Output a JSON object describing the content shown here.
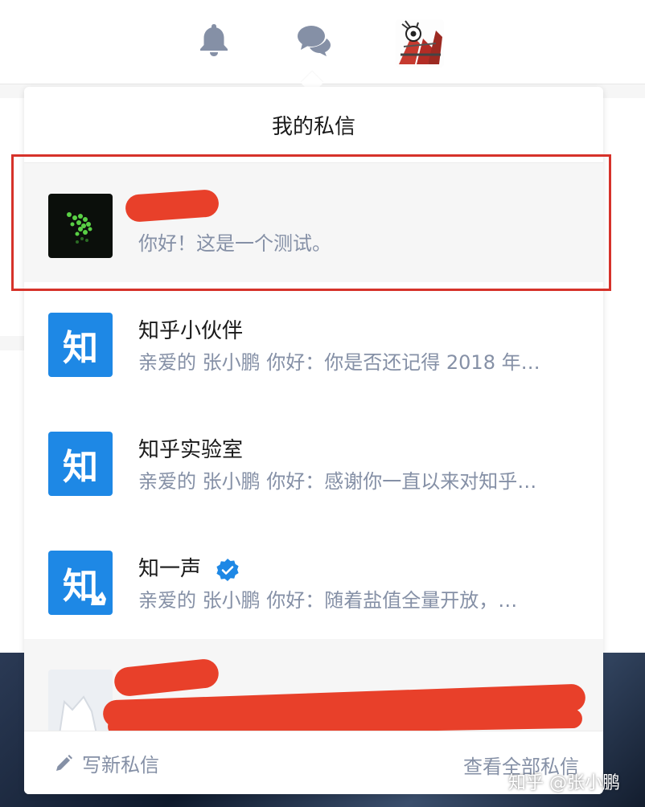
{
  "header": {
    "icons": [
      "bell-icon",
      "chat-bubbles-icon"
    ],
    "avatar": "user-avatar"
  },
  "popup": {
    "title": "我的私信",
    "conversations": [
      {
        "name": "",
        "message": "你好！这是一个测试。",
        "avatar": "green-dots-avatar",
        "redacted": true
      },
      {
        "name": "知乎小伙伴",
        "message": "亲爱的 张小鹏 你好：你是否还记得 2018 年…",
        "avatar_text": "知"
      },
      {
        "name": "知乎实验室",
        "message": "亲爱的 张小鹏 你好：感谢你一直以来对知乎…",
        "avatar_text": "知"
      },
      {
        "name": "知一声",
        "message": "亲爱的 张小鹏 你好：随着盐值全量开放，…",
        "avatar_text": "知",
        "verified": true
      },
      {
        "name": "",
        "message": "",
        "avatar": "dog-placeholder-avatar",
        "redacted": true
      }
    ],
    "footer": {
      "compose_label": "写新私信",
      "view_all_label": "查看全部私信"
    }
  },
  "watermark": "知乎 @张小鹏",
  "colors": {
    "brand_blue": "#1e88e5",
    "muted_text": "#8590a6",
    "redaction": "#e8402a",
    "highlight_border": "#d6322a"
  }
}
